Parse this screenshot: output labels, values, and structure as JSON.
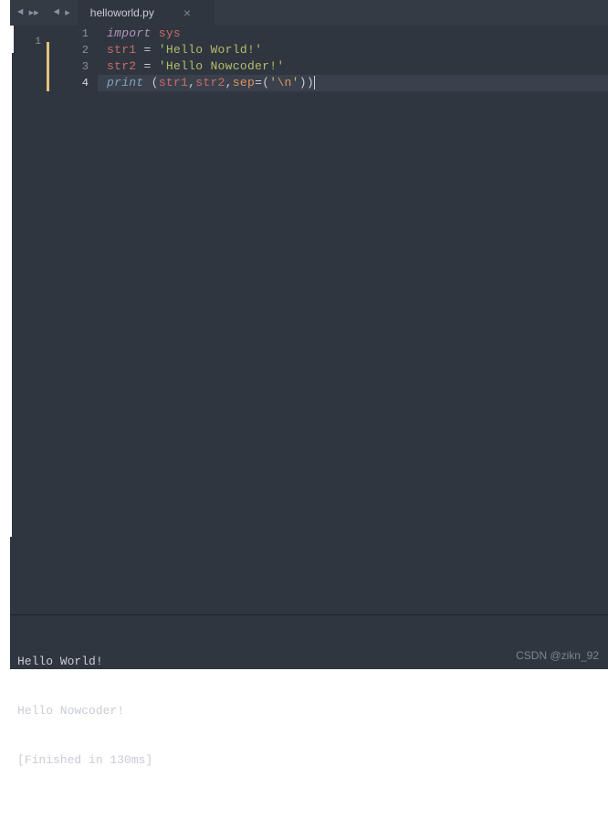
{
  "tab": {
    "title": "helloworld.py"
  },
  "minimap": {
    "line": "1"
  },
  "gutter": {
    "lines": [
      "1",
      "2",
      "3",
      "4"
    ],
    "activeIndex": 3
  },
  "code": {
    "l1": {
      "kw": "import",
      "mod": "sys"
    },
    "l2": {
      "var": "str1",
      "eq": "=",
      "q1": "'",
      "txt": "Hello World!",
      "q2": "'"
    },
    "l3": {
      "var": "str2",
      "eq": "=",
      "q1": "'",
      "txt": "Hello Nowcoder!",
      "q2": "'"
    },
    "l4": {
      "fn": "print",
      "sp": " ",
      "op": "(",
      "a1": "str1",
      "c1": ",",
      "a2": "str2",
      "c2": ",",
      "kw": "sep",
      "eq": "=",
      "op2": "(",
      "q1": "'",
      "esc": "\\n",
      "q2": "'",
      "cp2": ")",
      "cp": ")"
    }
  },
  "console": {
    "l1": "Hello World!",
    "l2": "Hello Nowcoder!",
    "l3": "[Finished in 130ms]"
  },
  "watermark": "CSDN @zikn_92"
}
